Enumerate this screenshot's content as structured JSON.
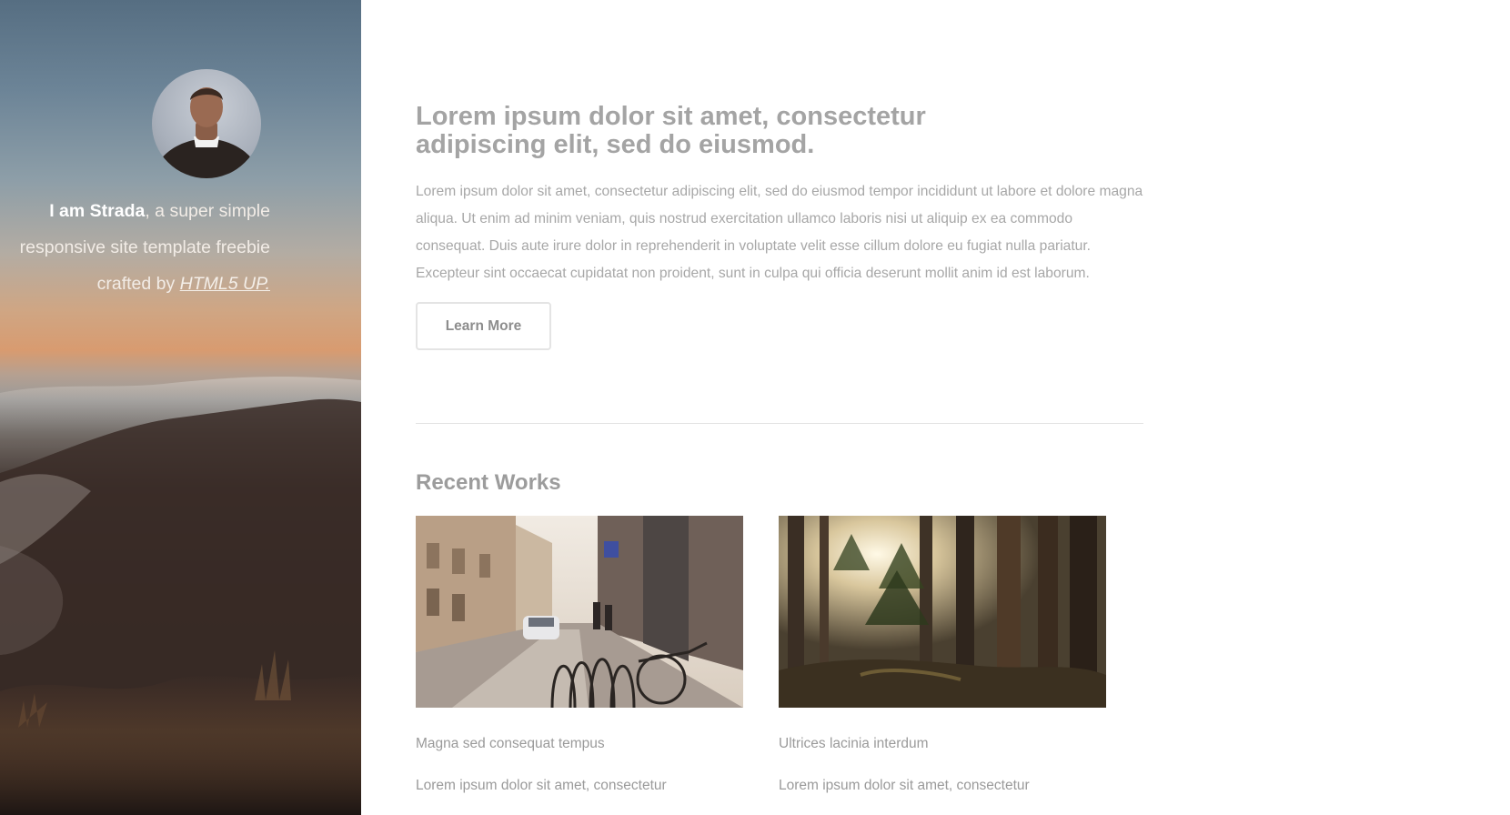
{
  "sidebar": {
    "intro_strong": "I am Strada",
    "intro_rest": ", a super simple",
    "intro_line2": "responsive site template freebie",
    "intro_line3_prefix": "crafted by ",
    "intro_link": "HTML5 UP."
  },
  "main": {
    "headline": "Lorem ipsum dolor sit amet, consectetur adipiscing elit, sed do eiusmod.",
    "lead": "Lorem ipsum dolor sit amet, consectetur adipiscing elit, sed do eiusmod tempor incididunt ut labore et dolore magna aliqua. Ut enim ad minim veniam, quis nostrud exercitation ullamco laboris nisi ut aliquip ex ea commodo consequat. Duis aute irure dolor in reprehenderit in voluptate velit esse cillum dolore eu fugiat nulla pariatur. Excepteur sint occaecat cupidatat non proident, sunt in culpa qui officia deserunt mollit anim id est laborum.",
    "button_label": "Learn More"
  },
  "recent_works": {
    "title": "Recent Works",
    "items": [
      {
        "caption": "Magna sed consequat tempus",
        "description": "Lorem ipsum dolor sit amet, consectetur"
      },
      {
        "caption": "Ultrices lacinia interdum",
        "description": "Lorem ipsum dolor sit amet, consectetur"
      }
    ]
  },
  "colors": {
    "heading": "#a4a4a4",
    "body_text": "#a7a7a7",
    "button_border": "#e4e4e4",
    "divider": "#e2e2e2"
  }
}
